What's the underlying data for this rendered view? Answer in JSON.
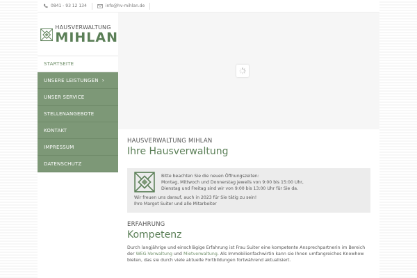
{
  "topbar": {
    "phone_icon": "phone-icon",
    "phone": "0841 - 93 12 134",
    "mail_icon": "envelope-icon",
    "email": "info@hv-mihlan.de"
  },
  "logo": {
    "line1": "HAUSVERWALTUNG",
    "line2": "MIHLAN"
  },
  "nav": {
    "items": [
      {
        "label": "STARTSEITE"
      },
      {
        "label": "UNSERE LEISTUNGEN",
        "chevron": "›"
      },
      {
        "label": "UNSER SERVICE"
      },
      {
        "label": "STELLENANGEBOTE"
      },
      {
        "label": "KONTAKT"
      },
      {
        "label": "IMPRESSUM"
      },
      {
        "label": "DATENSCHUTZ"
      }
    ]
  },
  "intro": {
    "kicker": "HAUSVERWALTUNG MIHLAN",
    "title": "Ihre Hausverwaltung"
  },
  "notice": {
    "line1": "Bitte beachten Sie die neuen Öffnungszeiten:",
    "line2": "Montag, Mittwoch und Donnerstag jeweils von 9:00 bis 15:00 Uhr,",
    "line3": "Dienstag und Freitag sind wir von 9:00 bis 13:00 Uhr für Sie da.",
    "line4": "Wir freuen uns darauf, auch in 2023 für Sie tätig zu sein!",
    "line5": "Ihre Margot Suiter und alle Mitarbeiter"
  },
  "experience": {
    "kicker": "ERFAHRUNG",
    "title": "Kompetenz",
    "para_a": "Durch langjährige und einschlägige Erfahrung ist Frau Suiter eine kompetente Ansprechpartnerin im Bereich der ",
    "link1": "WEG-Verwaltung",
    "para_b": " und ",
    "link2": "Mietverwaltung",
    "para_c": ". Als Immobilienfachwirtin kann sie Ihnen umfangreiches Knowhow bieten, das sie durch viele aktuelle Fortbildungen fortwährend aktualisiert."
  },
  "colors": {
    "brand_green": "#5b7f57",
    "nav_green": "#7d9877"
  }
}
